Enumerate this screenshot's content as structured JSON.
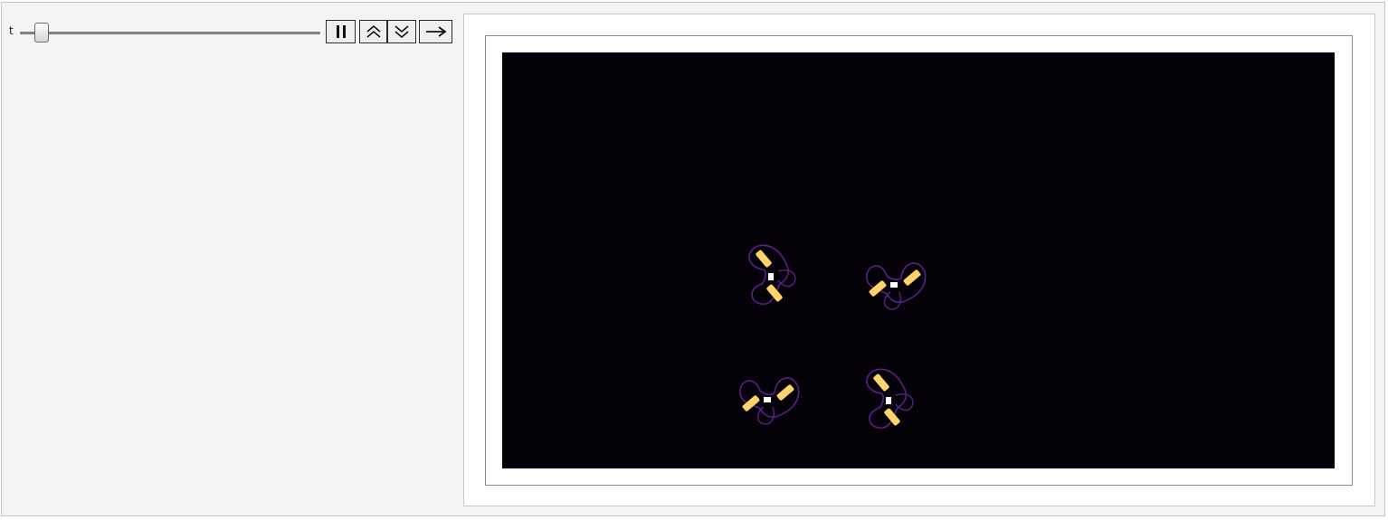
{
  "manipulator": {
    "parameter_label": "t",
    "slider_value": 0.05
  },
  "buttons": [
    {
      "name": "pause-button",
      "icon": "pause-icon"
    },
    {
      "name": "faster-button",
      "icon": "chevron-double-up-icon"
    },
    {
      "name": "slower-button",
      "icon": "chevron-double-down-icon"
    },
    {
      "name": "direction-button",
      "icon": "arrow-right-icon"
    }
  ],
  "colors": {
    "background": "#040208",
    "outline": "#5a1f86",
    "highlight": "#fdd36a",
    "core": "#ffffff"
  }
}
